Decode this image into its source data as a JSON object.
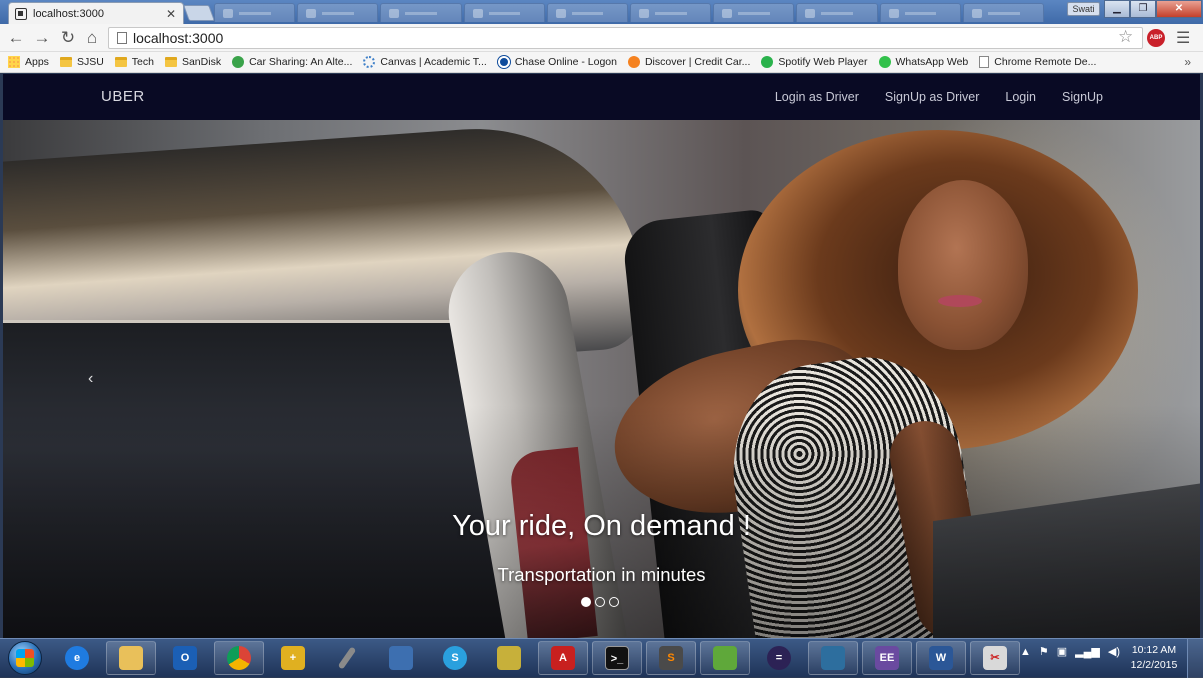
{
  "browser": {
    "active_tab": {
      "title": "localhost:3000"
    },
    "url": "localhost:3000",
    "user_badge": "Swati",
    "bookmarks": [
      {
        "label": "Apps",
        "icon": "apps-icon"
      },
      {
        "label": "SJSU",
        "icon": "folder-icon"
      },
      {
        "label": "Tech",
        "icon": "folder-icon"
      },
      {
        "label": "SanDisk",
        "icon": "folder-icon"
      },
      {
        "label": "Car Sharing: An Alte...",
        "icon": "zipcar-icon"
      },
      {
        "label": "Canvas | Academic T...",
        "icon": "canvas-icon"
      },
      {
        "label": "Chase Online - Logon",
        "icon": "chase-icon"
      },
      {
        "label": "Discover | Credit Car...",
        "icon": "discover-icon"
      },
      {
        "label": "Spotify Web Player",
        "icon": "spotify-icon"
      },
      {
        "label": "WhatsApp Web",
        "icon": "whatsapp-icon"
      },
      {
        "label": "Chrome Remote De...",
        "icon": "document-icon"
      }
    ]
  },
  "page": {
    "brand": "UBER",
    "nav_links": [
      {
        "label": "Login as Driver"
      },
      {
        "label": "SignUp as Driver"
      },
      {
        "label": "Login"
      },
      {
        "label": "SignUp"
      }
    ],
    "carousel": {
      "title": "Your ride, On demand !",
      "subtitle": "Transportation in minutes",
      "active_index": 0,
      "slide_count": 3
    },
    "colors": {
      "navbar_bg": "#090a24",
      "caption_text": "#ffffff"
    }
  },
  "taskbar": {
    "clock_time": "10:12 AM",
    "clock_date": "12/2/2015"
  }
}
